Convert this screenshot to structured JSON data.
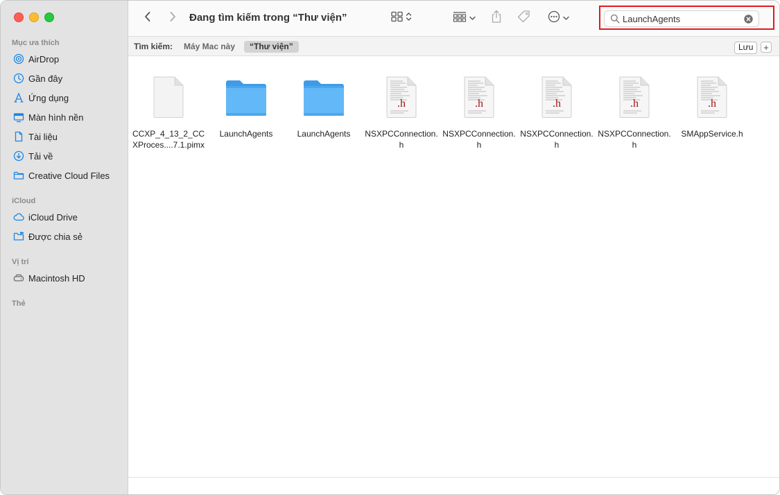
{
  "window": {
    "title": "Đang tìm kiếm trong “Thư viện”"
  },
  "sidebar": {
    "sections": [
      {
        "title": "Mục ưa thích",
        "items": [
          {
            "label": "AirDrop",
            "icon": "airdrop-icon"
          },
          {
            "label": "Gần đây",
            "icon": "clock-icon"
          },
          {
            "label": "Ứng dụng",
            "icon": "apps-icon"
          },
          {
            "label": "Màn hình nền",
            "icon": "desktop-icon"
          },
          {
            "label": "Tài liệu",
            "icon": "document-icon"
          },
          {
            "label": "Tải về",
            "icon": "download-icon"
          },
          {
            "label": "Creative Cloud Files",
            "icon": "folder-icon"
          }
        ]
      },
      {
        "title": "iCloud",
        "items": [
          {
            "label": "iCloud Drive",
            "icon": "cloud-icon"
          },
          {
            "label": "Được chia sẻ",
            "icon": "shared-folder-icon"
          }
        ]
      },
      {
        "title": "Vị trí",
        "items": [
          {
            "label": "Macintosh HD",
            "icon": "disk-icon"
          }
        ]
      },
      {
        "title": "Thẻ",
        "items": []
      }
    ]
  },
  "search": {
    "value": "LaunchAgents"
  },
  "scope": {
    "label": "Tìm kiếm:",
    "options": [
      "Máy Mac này",
      "“Thư viện”"
    ],
    "selected": "“Thư viện”",
    "save_label": "Lưu",
    "add_label": "+"
  },
  "files": [
    {
      "name": "CCXP_4_13_2_CCXProces....7.1.pimx",
      "kind": "generic-file"
    },
    {
      "name": "LaunchAgents",
      "kind": "folder"
    },
    {
      "name": "LaunchAgents",
      "kind": "folder"
    },
    {
      "name": "NSXPCConnection.h",
      "kind": "header-file",
      "badge": ".h"
    },
    {
      "name": "NSXPCConnection.h",
      "kind": "header-file",
      "badge": ".h"
    },
    {
      "name": "NSXPCConnection.h",
      "kind": "header-file",
      "badge": ".h"
    },
    {
      "name": "NSXPCConnection.h",
      "kind": "header-file",
      "badge": ".h"
    },
    {
      "name": "SMAppService.h",
      "kind": "header-file",
      "badge": ".h"
    }
  ],
  "colors": {
    "accent": "#1a84e6",
    "folder": "#5fb3f5",
    "highlight": "#e0191e",
    "header_badge": "#a01414"
  }
}
